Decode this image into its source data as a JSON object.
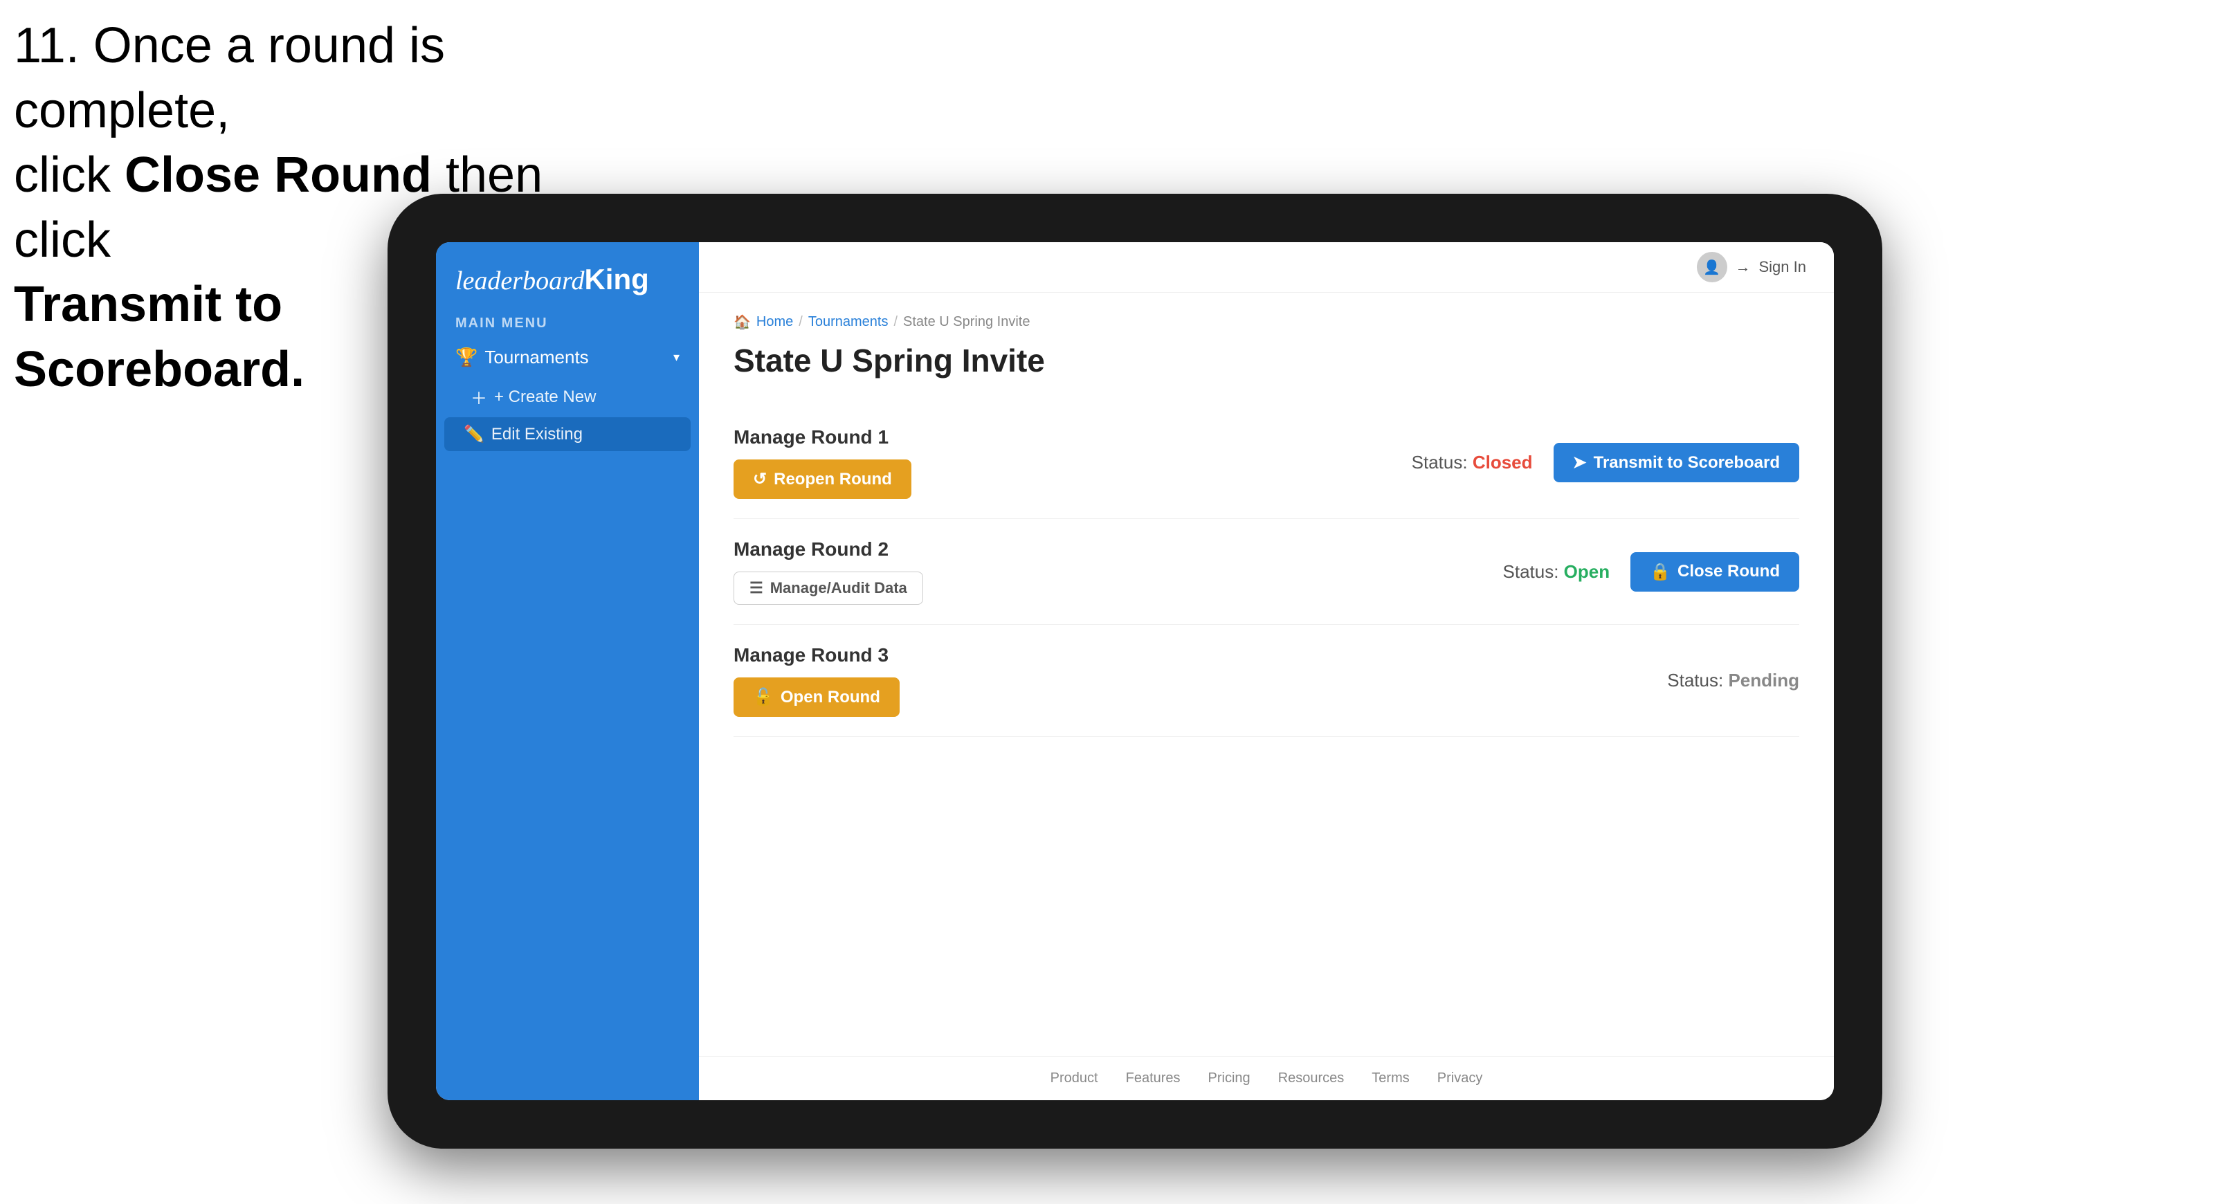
{
  "instruction": {
    "line1": "11. Once a round is complete,",
    "line2_prefix": "click ",
    "line2_bold": "Close Round",
    "line2_suffix": " then click",
    "line3_bold": "Transmit to Scoreboard."
  },
  "header": {
    "sign_in": "Sign In"
  },
  "sidebar": {
    "logo_prefix": "leaderboard",
    "logo_bold": "King",
    "main_menu_label": "MAIN MENU",
    "tournaments_label": "Tournaments",
    "create_new_label": "+ Create New",
    "edit_existing_label": "Edit Existing"
  },
  "breadcrumb": {
    "home": "Home",
    "sep1": "/",
    "tournaments": "Tournaments",
    "sep2": "/",
    "current": "State U Spring Invite"
  },
  "page": {
    "title": "State U Spring Invite"
  },
  "rounds": [
    {
      "id": "round1",
      "title": "Manage Round 1",
      "status_label": "Status:",
      "status_value": "Closed",
      "status_class": "status-closed",
      "buttons": [
        {
          "id": "reopen-round-1",
          "label": "Reopen Round",
          "type": "gold",
          "icon": "↺"
        },
        {
          "id": "transmit-scoreboard-1",
          "label": "Transmit to Scoreboard",
          "type": "blue",
          "icon": "➤"
        }
      ]
    },
    {
      "id": "round2",
      "title": "Manage Round 2",
      "status_label": "Status:",
      "status_value": "Open",
      "status_class": "status-open",
      "buttons": [
        {
          "id": "manage-audit-2",
          "label": "Manage/Audit Data",
          "type": "audit",
          "icon": "☰"
        },
        {
          "id": "close-round-2",
          "label": "Close Round",
          "type": "blue",
          "icon": "🔒"
        }
      ]
    },
    {
      "id": "round3",
      "title": "Manage Round 3",
      "status_label": "Status:",
      "status_value": "Pending",
      "status_class": "status-pending",
      "buttons": [
        {
          "id": "open-round-3",
          "label": "Open Round",
          "type": "gold",
          "icon": "🔓"
        }
      ]
    }
  ],
  "footer": {
    "links": [
      "Product",
      "Features",
      "Pricing",
      "Resources",
      "Terms",
      "Privacy"
    ]
  }
}
